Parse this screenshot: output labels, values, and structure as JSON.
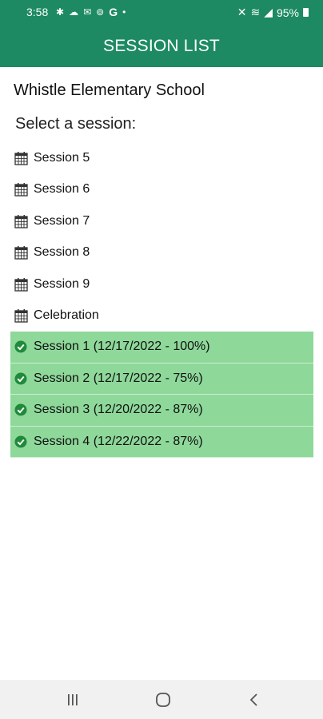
{
  "status_bar": {
    "time": "3:58",
    "carrier_letter": "G",
    "battery": "95%"
  },
  "header": {
    "title": "SESSION LIST"
  },
  "school": {
    "name": "Whistle Elementary School"
  },
  "prompt": "Select a session:",
  "sessions": [
    {
      "label": "Session 5",
      "completed": false
    },
    {
      "label": "Session 6",
      "completed": false
    },
    {
      "label": "Session 7",
      "completed": false
    },
    {
      "label": "Session 8",
      "completed": false
    },
    {
      "label": "Session 9",
      "completed": false
    },
    {
      "label": "Celebration",
      "completed": false
    },
    {
      "label": "Session 1 (12/17/2022 - 100%)",
      "completed": true
    },
    {
      "label": "Session 2 (12/17/2022 - 75%)",
      "completed": true
    },
    {
      "label": "Session 3 (12/20/2022 - 87%)",
      "completed": true
    },
    {
      "label": "Session 4 (12/22/2022 - 87%)",
      "completed": true
    }
  ],
  "colors": {
    "primary": "#1d8a63",
    "completed_bg": "#8ed89a",
    "check": "#1f8a3a"
  },
  "icons": {
    "pending": "calendar-icon",
    "completed": "check-circle-icon"
  }
}
